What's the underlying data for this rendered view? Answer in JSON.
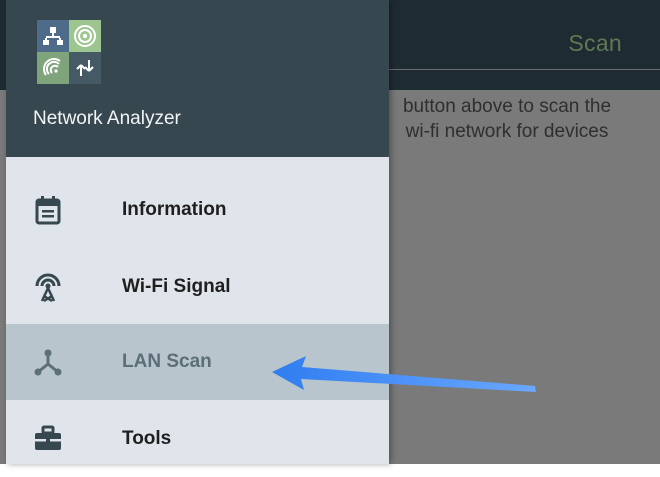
{
  "app": {
    "toolbar": {
      "scan_label": "Scan"
    },
    "hint_line1": "button above to scan the",
    "hint_line2": "wi-fi network for devices"
  },
  "drawer": {
    "app_name": "Network Analyzer",
    "logo_icons": [
      "lan-icon",
      "target-icon",
      "wifi-signal-icon",
      "transfer-icon"
    ],
    "items": [
      {
        "label": "Information",
        "icon": "calendar-icon",
        "active": false
      },
      {
        "label": "Wi-Fi Signal",
        "icon": "antenna-icon",
        "active": false
      },
      {
        "label": "LAN Scan",
        "icon": "lan-icon",
        "active": true
      },
      {
        "label": "Tools",
        "icon": "toolbox-icon",
        "active": false
      }
    ]
  },
  "colors": {
    "header": "#37474f",
    "drawer_bg": "#dfe5ea",
    "active_item": "#b8c5cc",
    "scan_action": "#5f7a52",
    "arrow": "#2f7df0"
  }
}
